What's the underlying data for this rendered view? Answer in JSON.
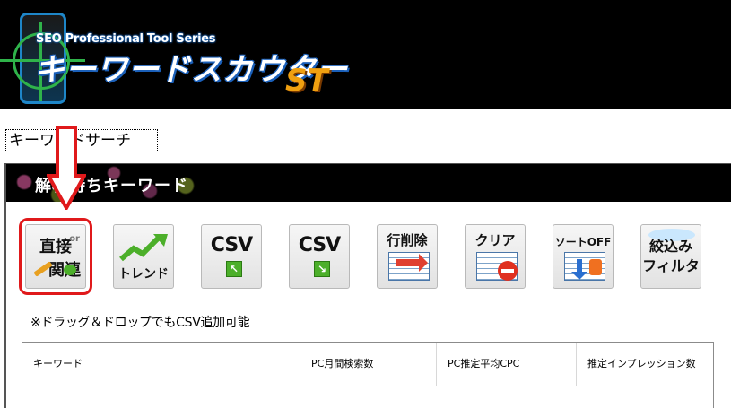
{
  "app": {
    "series": "SEO Professional Tool Series",
    "title": "キーワードスカウター",
    "edition": "ST"
  },
  "tabs": [
    {
      "label": "キーワードサーチ",
      "active": true
    }
  ],
  "panel": {
    "title": "解析待ちキーワード"
  },
  "toolbar": {
    "direct": {
      "line1": "直接",
      "or": "or",
      "line2": "関連"
    },
    "trend": {
      "label": "トレンド"
    },
    "csv_import": {
      "label": "CSV"
    },
    "csv_export": {
      "label": "CSV"
    },
    "delete_row": {
      "label": "行削除"
    },
    "clear": {
      "label": "クリア"
    },
    "sort_off": {
      "label": "ソートOFF"
    },
    "filter": {
      "line1": "絞込み",
      "line2": "フィルタ"
    }
  },
  "drop_note": "※ドラッグ＆ドロップでもCSV追加可能",
  "table": {
    "columns": [
      "キーワード",
      "PC月間検索数",
      "PC推定平均CPC",
      "推定インプレッション数"
    ]
  },
  "colors": {
    "highlight": "#e0191b",
    "accent_green": "#4caf2a",
    "accent_blue": "#1e86c8"
  }
}
